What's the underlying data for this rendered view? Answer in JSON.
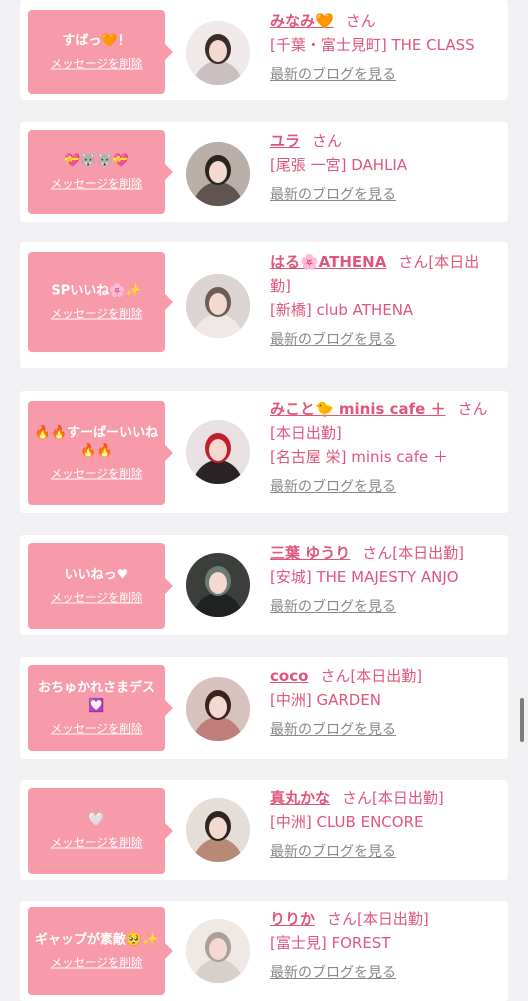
{
  "messages": [
    {
      "message": "すばっ🧡！",
      "delete_label": "メッセージを削除",
      "name": "みなみ🧡",
      "san": "さん",
      "status": "",
      "shop": "[千葉・富士見町] THE CLASS",
      "blog_label": "最新のブログを見る"
    },
    {
      "message": "💝🐺🐺💝",
      "delete_label": "メッセージを削除",
      "name": "ユラ",
      "san": "さん",
      "status": "",
      "shop": "[尾張 一宮] DAHLIA",
      "blog_label": "最新のブログを見る"
    },
    {
      "message": "SPいいね🌸✨",
      "delete_label": "メッセージを削除",
      "name": "はる🌸ATHENA",
      "san": "さん",
      "status": "[本日出勤]",
      "shop": "[新橋] club ATHENA",
      "blog_label": "最新のブログを見る"
    },
    {
      "message": "🔥🔥すーぱーいいね🔥🔥",
      "delete_label": "メッセージを削除",
      "name": "みこと🐤 minis cafe ＋",
      "san": "さん",
      "status": "[本日出勤]",
      "shop": "[名古屋 栄] minis cafe ＋",
      "blog_label": "最新のブログを見る"
    },
    {
      "message": "いいねっ♥",
      "delete_label": "メッセージを削除",
      "name": "三葉 ゆうり",
      "san": "さん",
      "status": "[本日出勤]",
      "shop": "[安城] THE MAJESTY ANJO",
      "blog_label": "最新のブログを見る"
    },
    {
      "message": "おちゅかれさまデス💟",
      "delete_label": "メッセージを削除",
      "name": "coco",
      "san": "さん",
      "status": "[本日出勤]",
      "shop": "[中洲] GARDEN",
      "blog_label": "最新のブログを見る"
    },
    {
      "message": "🤍",
      "delete_label": "メッセージを削除",
      "name": "真丸かな",
      "san": "さん",
      "status": "[本日出勤]",
      "shop": "[中洲] CLUB ENCORE",
      "blog_label": "最新のブログを見る"
    },
    {
      "message": "ギャップが素敵🥺✨",
      "delete_label": "メッセージを削除",
      "name": "りりか",
      "san": "さん",
      "status": "[本日出勤]",
      "shop": "[富士見] FOREST",
      "blog_label": "最新のブログを見る"
    }
  ],
  "colors": {
    "accent": "#e0557a",
    "bubble": "#f79aa9",
    "link": "#888888"
  }
}
